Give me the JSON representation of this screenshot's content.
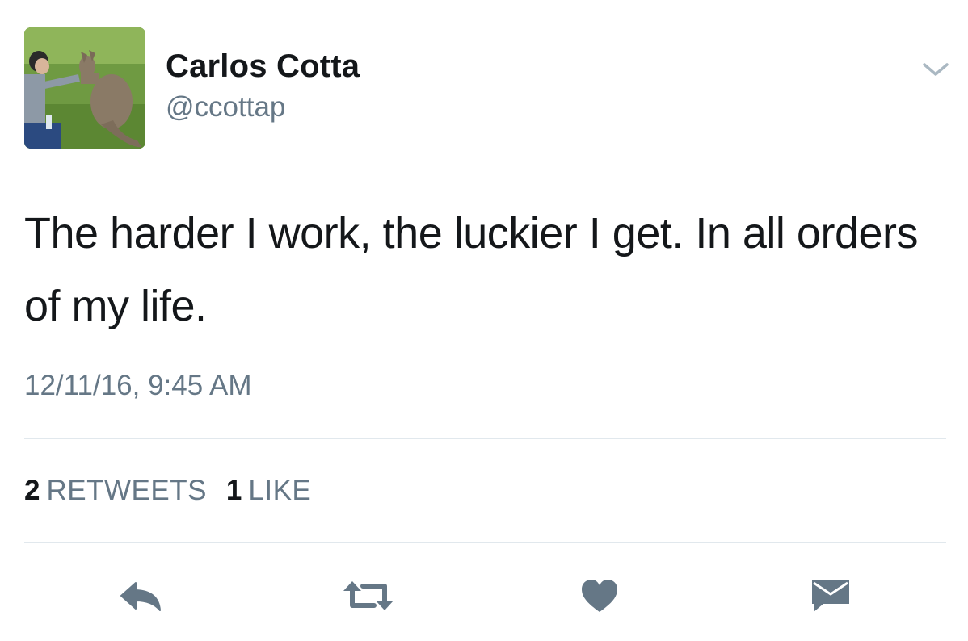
{
  "tweet": {
    "author_name": "Carlos Cotta",
    "author_handle": "@ccottap",
    "text": "The harder I work, the luckier I get. In all orders of my life.",
    "timestamp": "12/11/16, 9:45 AM",
    "retweet_count": "2",
    "retweet_label": "RETWEETS",
    "like_count": "1",
    "like_label": "LIKE"
  },
  "icons": {
    "menu": "chevron-down-icon",
    "reply": "reply-icon",
    "retweet": "retweet-icon",
    "like": "heart-icon",
    "message": "envelope-icon"
  },
  "colors": {
    "text": "#14171a",
    "secondary": "#657786",
    "divider": "#e1e8ed",
    "icon": "#657786",
    "chevron": "#aab8c2"
  }
}
